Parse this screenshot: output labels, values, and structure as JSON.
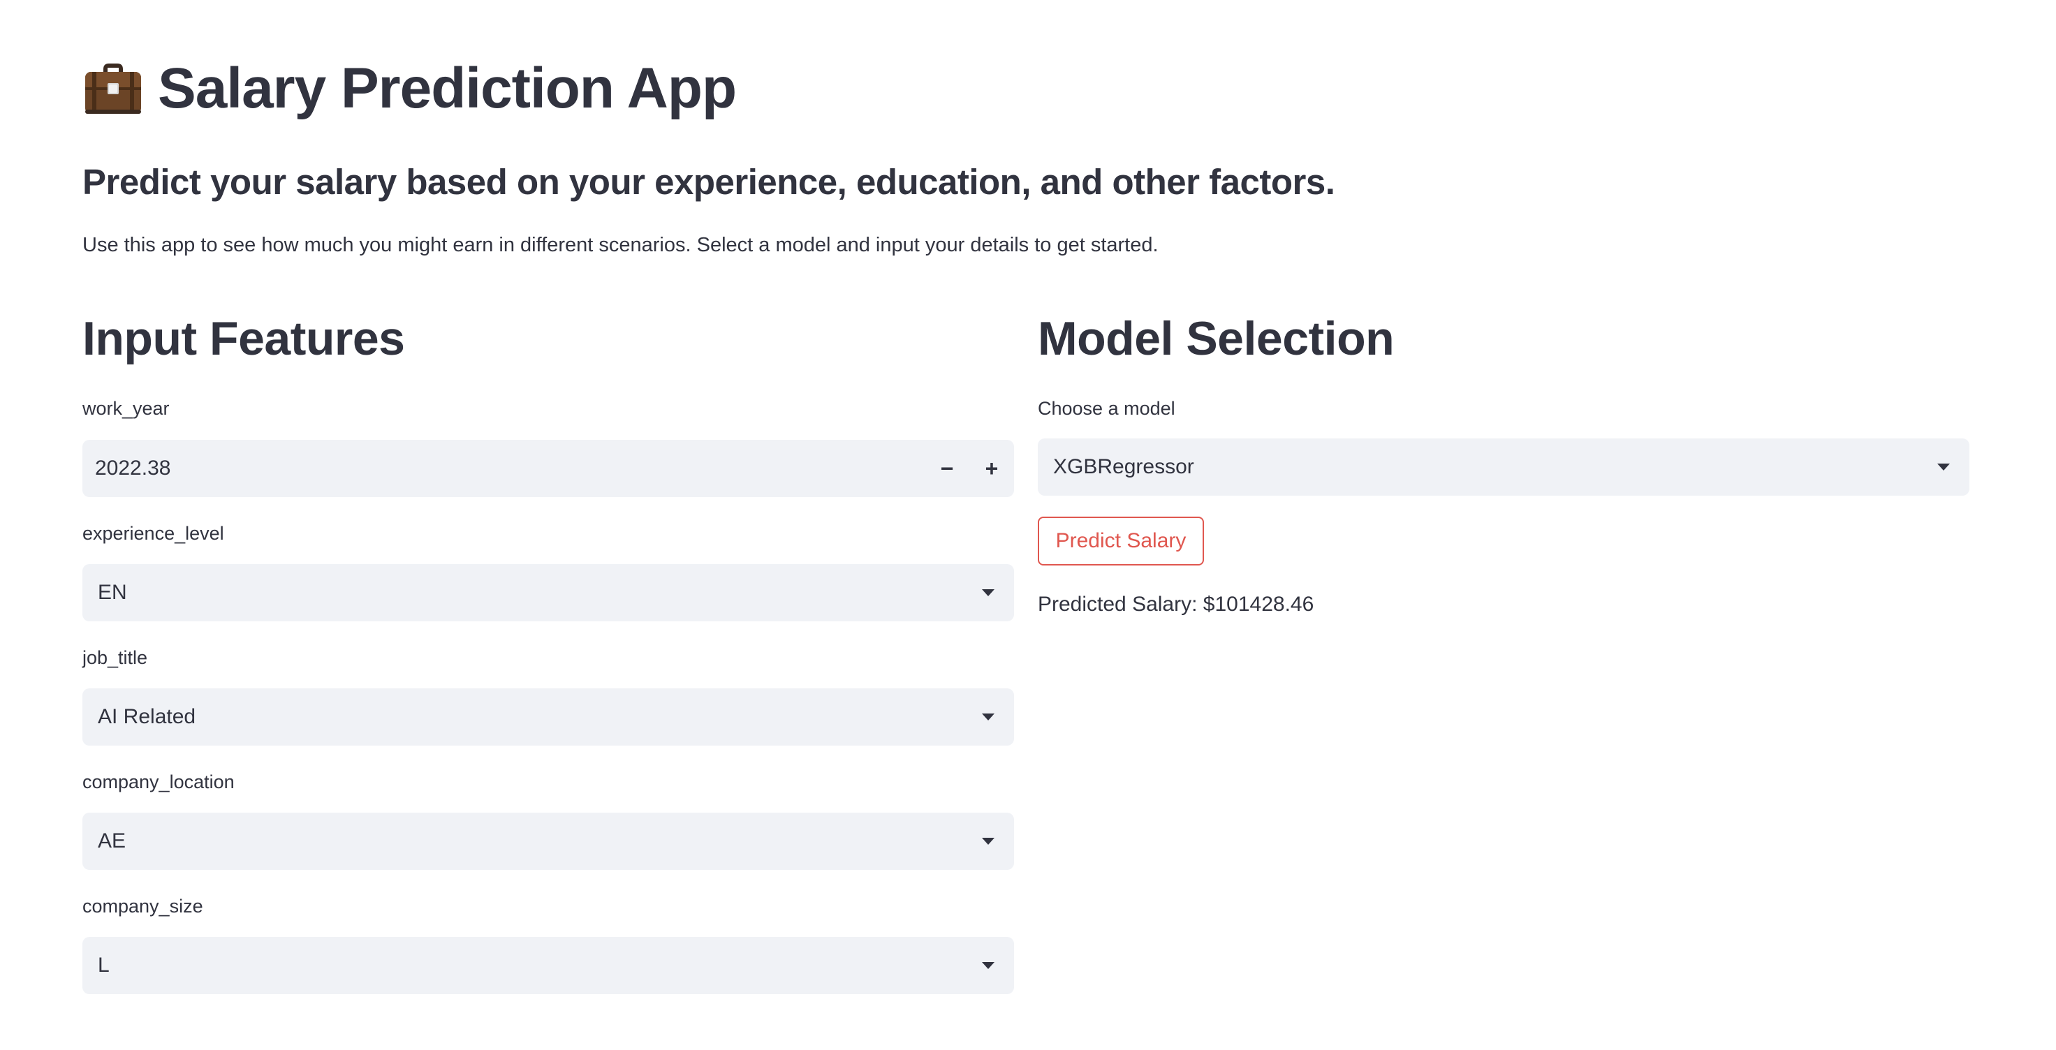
{
  "app": {
    "title": "Salary Prediction App",
    "subtitle": "Predict your salary based on your experience, education, and other factors.",
    "intro": "Use this app to see how much you might earn in different scenarios. Select a model and input your details to get started."
  },
  "input_features": {
    "heading": "Input Features",
    "work_year": {
      "label": "work_year",
      "value": "2022.38",
      "decrement": "−",
      "increment": "+"
    },
    "experience_level": {
      "label": "experience_level",
      "value": "EN"
    },
    "job_title": {
      "label": "job_title",
      "value": "AI Related"
    },
    "company_location": {
      "label": "company_location",
      "value": "AE"
    },
    "company_size": {
      "label": "company_size",
      "value": "L"
    }
  },
  "model_selection": {
    "heading": "Model Selection",
    "model_label": "Choose a model",
    "model_value": "XGBRegressor",
    "predict_button": "Predict Salary",
    "result": "Predicted Salary: $101428.46"
  },
  "colors": {
    "text": "#31333f",
    "field_bg": "#f0f2f6",
    "accent": "#e0574f"
  },
  "icons": {
    "title_icon": "briefcase-icon",
    "dropdown_icon": "chevron-down-icon"
  }
}
